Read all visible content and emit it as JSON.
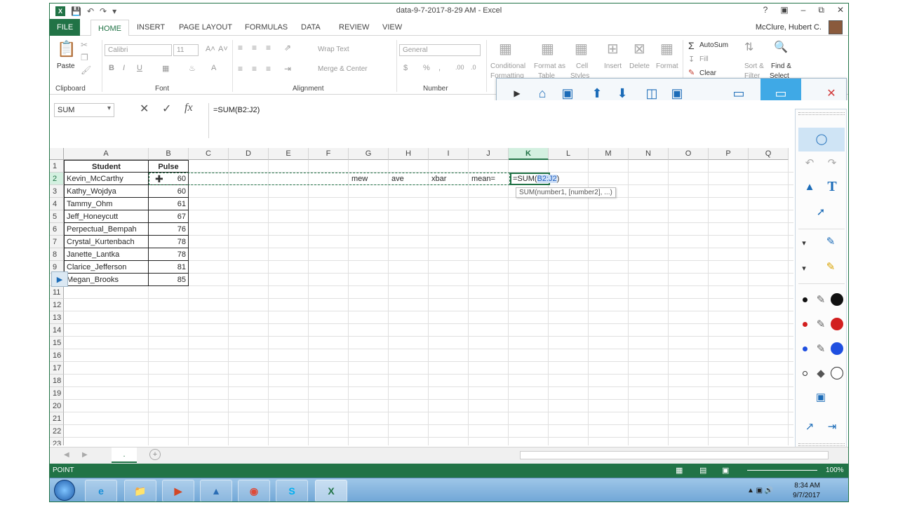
{
  "window": {
    "title": "data-9-7-2017-8-29 AM - Excel",
    "user": "McClure, Hubert C."
  },
  "tabs": [
    "FILE",
    "HOME",
    "INSERT",
    "PAGE LAYOUT",
    "FORMULAS",
    "DATA",
    "REVIEW",
    "VIEW"
  ],
  "ribbon": {
    "clipboard": {
      "paste": "Paste",
      "label": "Clipboard"
    },
    "font": {
      "name": "Calibri",
      "size": "11",
      "label": "Font"
    },
    "alignment": {
      "wrap": "Wrap Text",
      "merge": "Merge & Center",
      "label": "Alignment"
    },
    "number": {
      "format": "General",
      "label": "Number"
    },
    "styles": {
      "cond": "Conditional",
      "cond2": "Formatting",
      "fmt_table": "Format as",
      "fmt_table2": "Table",
      "cell_styles": "Cell",
      "cell_styles2": "Styles"
    },
    "cells": {
      "insert": "Insert",
      "delete": "Delete",
      "format": "Format"
    },
    "editing": {
      "autosum": "AutoSum",
      "fill": "Fill",
      "clear": "Clear",
      "sort": "Sort &",
      "sort2": "Filter",
      "find": "Find &",
      "find2": "Select"
    }
  },
  "formula_bar": {
    "name_box": "SUM",
    "formula": "=SUM(B2:J2)"
  },
  "columns": [
    "A",
    "B",
    "C",
    "D",
    "E",
    "F",
    "G",
    "H",
    "I",
    "J",
    "K",
    "L",
    "M",
    "N",
    "O",
    "P",
    "Q"
  ],
  "rows": [
    "1",
    "2",
    "3",
    "4",
    "5",
    "6",
    "7",
    "8",
    "9",
    "10",
    "11",
    "12",
    "13",
    "14",
    "15",
    "16",
    "17",
    "18",
    "19",
    "20",
    "21",
    "22",
    "23"
  ],
  "headers": {
    "student": "Student",
    "pulse": "Pulse"
  },
  "students": [
    {
      "name": "Kevin_McCarthy",
      "pulse": "60"
    },
    {
      "name": "Kathy_Wojdya",
      "pulse": "60"
    },
    {
      "name": "Tammy_Ohm",
      "pulse": "61"
    },
    {
      "name": "Jeff_Honeycutt",
      "pulse": "67"
    },
    {
      "name": "Perpectual_Bempah",
      "pulse": "76"
    },
    {
      "name": "Crystal_Kurtenbach",
      "pulse": "78"
    },
    {
      "name": "Janette_Lantka",
      "pulse": "78"
    },
    {
      "name": "Clarice_Jefferson",
      "pulse": "81"
    },
    {
      "name": "Megan_Brooks",
      "pulse": "85"
    }
  ],
  "row2_labels": {
    "g": "mew",
    "h": "ave",
    "i": "xbar",
    "j": "mean="
  },
  "editing_cell": {
    "pre": "=SUM(",
    "ref": "B2:J2",
    "post": ")"
  },
  "tooltip": "SUM(number1, [number2], ...)",
  "sheet_tab": ".",
  "status": {
    "mode": "POINT",
    "zoom": "100%"
  },
  "clock": {
    "time": "8:34 AM",
    "date": "9/7/2017"
  },
  "colors": {
    "excel_green": "#217346",
    "ref_blue": "#1f5fbf"
  }
}
